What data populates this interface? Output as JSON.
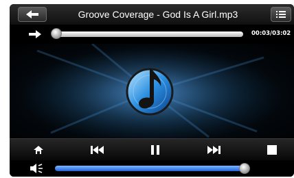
{
  "header": {
    "title": "Groove Coverage - God Is A Girl.mp3"
  },
  "playback": {
    "time": "00:03/03:02",
    "progress": 0.0
  },
  "volume": {
    "level": 0.99
  },
  "icons": {
    "back": "back-arrow-icon",
    "playlist": "list-icon",
    "repeat": "arrow-right-icon",
    "art": "music-note-icon",
    "home": "home-icon",
    "prev": "previous-icon",
    "pause": "pause-icon",
    "next": "next-icon",
    "stop": "stop-icon",
    "volume": "speaker-icon"
  },
  "colors": {
    "accent": "#2f7ae6",
    "bar": "#0f0f0f"
  }
}
